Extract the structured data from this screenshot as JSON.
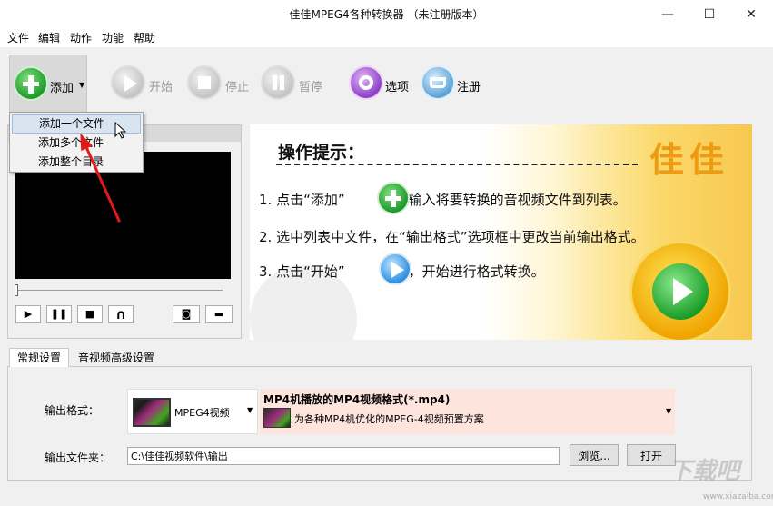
{
  "window": {
    "title": "佳佳MPEG4各种转换器 （未注册版本）",
    "min_glyph": "—",
    "max_glyph": "☐",
    "close_glyph": "✕"
  },
  "menu": [
    "文件",
    "编辑",
    "动作",
    "功能",
    "帮助"
  ],
  "toolbar": {
    "add": "添加",
    "start": "开始",
    "stop": "停止",
    "pause": "暂停",
    "options": "选项",
    "register": "注册",
    "caret": "▼"
  },
  "dropdown": [
    "添加一个文件",
    "添加多个文件",
    "添加整个目录"
  ],
  "player": {
    "play_glyph": "▶",
    "pause_glyph": "❚❚",
    "stop_glyph": "■",
    "loop_glyph": "∩",
    "snapshot_glyph": "◙",
    "folder_glyph": "▬"
  },
  "tips": {
    "title": "操作提示：",
    "line1_a": "1. 点击“添加”",
    "line1_b": "按钮输入将要转换的音视频文件到列表。",
    "line2": "2. 选中列表中文件，在“输出格式”选项框中更改当前输出格式。",
    "line3_a": "3. 点击“开始”",
    "line3_b": "按钮，开始进行格式转换。",
    "logo": "佳佳"
  },
  "tabs": [
    "常规设置",
    "音视频高级设置"
  ],
  "settings": {
    "output_format_label": "输出格式：",
    "format_short": "MPEG4视频",
    "format_title": "MP4机播放的MP4视频格式(*.mp4)",
    "format_desc": "为各种MP4机优化的MPEG-4视频预置方案",
    "output_folder_label": "输出文件夹：",
    "output_folder_value": "C:\\佳佳视频软件\\输出",
    "browse": "浏览...",
    "open": "打开",
    "caret": "▼"
  },
  "watermark": {
    "main": "下载吧",
    "sub": "www.xiazaiba.com"
  }
}
